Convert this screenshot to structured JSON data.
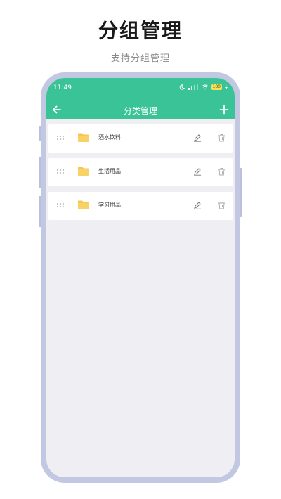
{
  "promo": {
    "title": "分组管理",
    "subtitle": "支持分组管理"
  },
  "status_bar": {
    "time": "11:49",
    "battery": "100"
  },
  "nav": {
    "title": "分类管理",
    "back_icon": "arrow-left-icon",
    "add_icon": "plus-icon"
  },
  "categories": [
    {
      "label": "酒水饮料"
    },
    {
      "label": "生活用品"
    },
    {
      "label": "学习用品"
    }
  ],
  "colors": {
    "header": "#3bc398",
    "folder": "#f6c650",
    "frame": "#c3c8e2",
    "screen_bg": "#efeff3"
  }
}
